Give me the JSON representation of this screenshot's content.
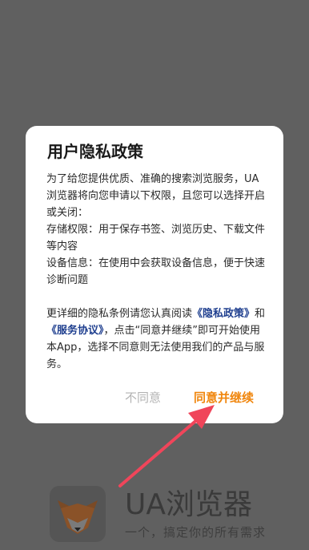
{
  "splash": {
    "app_name": "UA浏览器",
    "slogan": "一个，搞定你的所有需求"
  },
  "dialog": {
    "title": "用户隐私政策",
    "intro": "为了给您提供优质、准确的搜索浏览服务，UA浏览器将向您申请以下权限，且您可以选择开启或关闭：",
    "storage_permission": "存储权限：用于保存书签、浏览历史、下载文件等内容",
    "device_info": "设备信息：在使用中会获取设备信息，便于快速诊断问题",
    "more_prefix": "更详细的隐私条例请您认真阅读",
    "privacy_link": "《隐私政策》",
    "and_text": "和",
    "service_link": "《服务协议》",
    "more_suffix": "，点击“同意并继续”即可开始使用本App，选择不同意则无法使用我们的产品与服务。",
    "decline_label": "不同意",
    "accept_label": "同意并继续"
  },
  "colors": {
    "overlay_bg": "#606060",
    "accent": "#f0860d",
    "link": "#1f3f8f",
    "annotation_arrow": "#f0455a"
  },
  "icons": {
    "app_logo": "fox-logo-icon"
  }
}
